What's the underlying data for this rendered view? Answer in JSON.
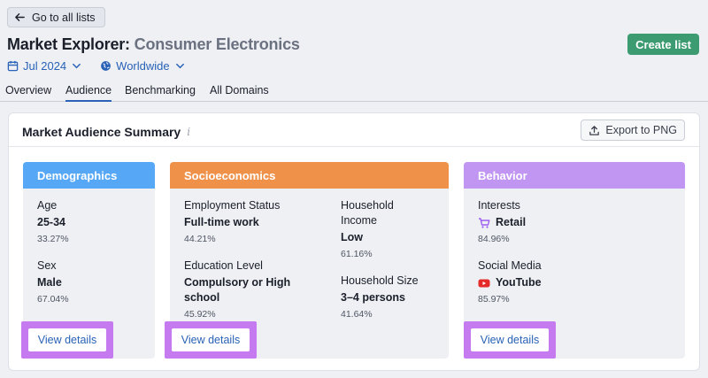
{
  "header": {
    "back_label": "Go to all lists",
    "title_main": "Market Explorer:",
    "title_sub": "Consumer Electronics",
    "create_label": "Create list",
    "date_filter": "Jul 2024",
    "region_filter": "Worldwide"
  },
  "tabs": [
    "Overview",
    "Audience",
    "Benchmarking",
    "All Domains"
  ],
  "active_tab": "Audience",
  "panel": {
    "title": "Market Audience Summary",
    "export_label": "Export to PNG"
  },
  "cards": {
    "demographics": {
      "title": "Demographics",
      "age": {
        "label": "Age",
        "value": "25-34",
        "pct": "33.27%"
      },
      "sex": {
        "label": "Sex",
        "value": "Male",
        "pct": "67.04%"
      },
      "view_label": "View details"
    },
    "socioeconomics": {
      "title": "Socioeconomics",
      "employment": {
        "label": "Employment Status",
        "value": "Full-time work",
        "pct": "44.21%"
      },
      "education": {
        "label": "Education Level",
        "value_line1": "Compulsory or High",
        "value_line2": "school",
        "pct": "45.92%"
      },
      "income": {
        "label_line1": "Household",
        "label_line2": "Income",
        "value": "Low",
        "pct": "61.16%"
      },
      "household_size": {
        "label": "Household Size",
        "value": "3–4 persons",
        "pct": "41.64%"
      },
      "view_label": "View details"
    },
    "behavior": {
      "title": "Behavior",
      "interests": {
        "label": "Interests",
        "value": "Retail",
        "pct": "84.96%"
      },
      "social": {
        "label": "Social Media",
        "value": "YouTube",
        "pct": "85.97%"
      },
      "view_label": "View details"
    }
  },
  "colors": {
    "demographics": "#56a8f6",
    "socioeconomics": "#f0914a",
    "behavior": "#c196f3",
    "highlight": "#c57af0",
    "link": "#2962b6",
    "create": "#3c9b70"
  }
}
